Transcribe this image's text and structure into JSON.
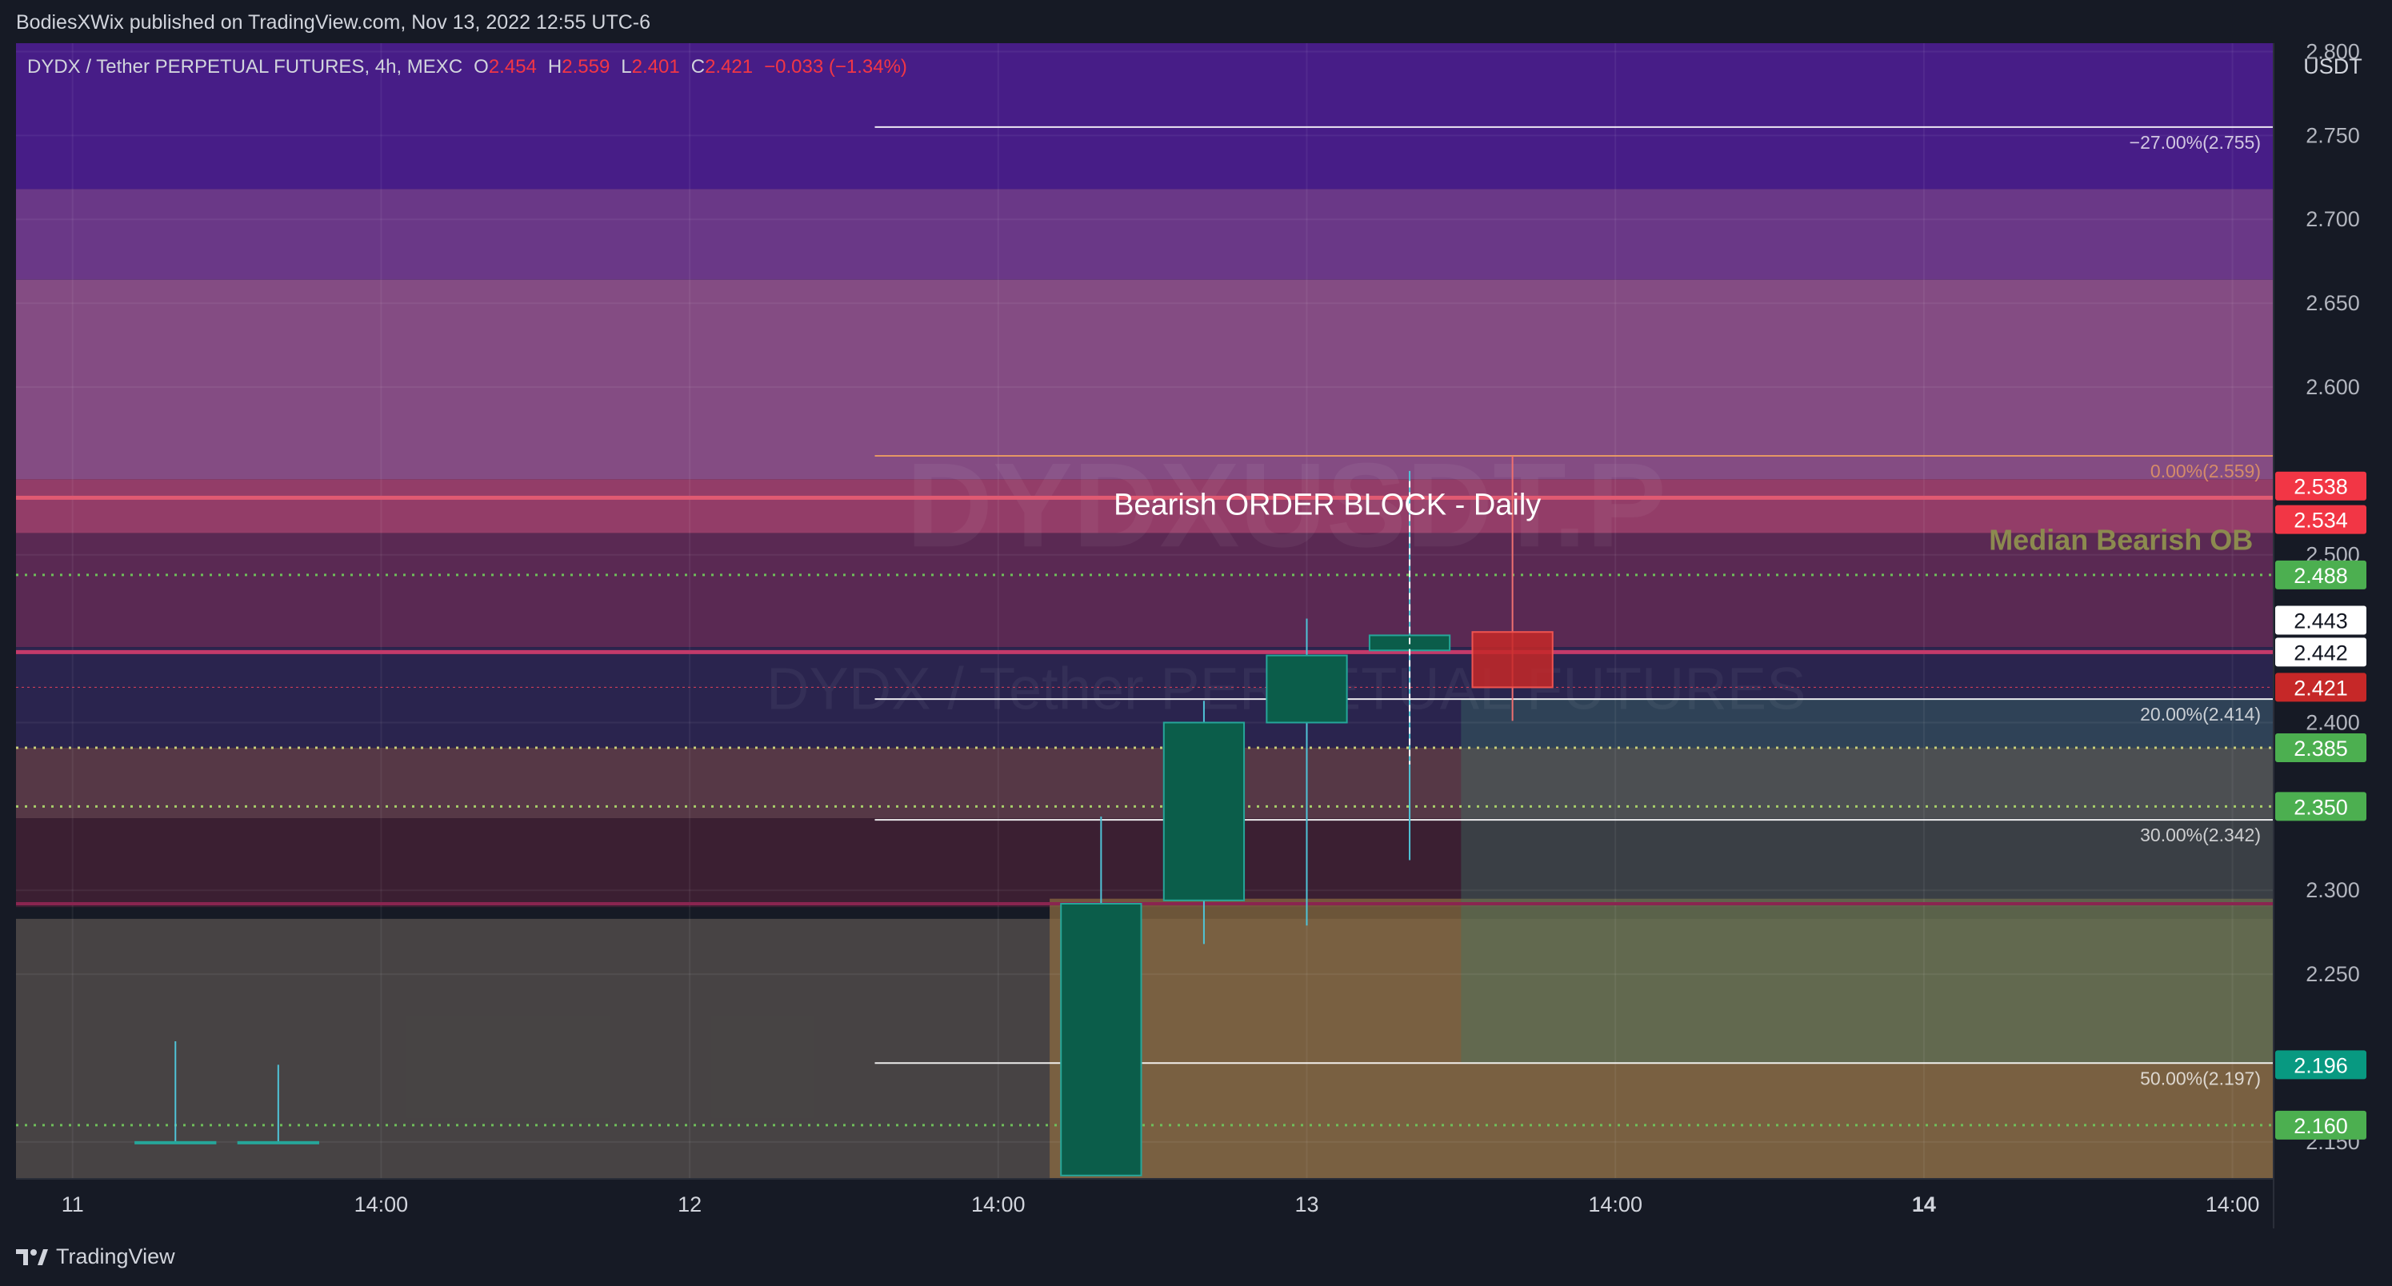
{
  "header": {
    "published": "BodiesXWix published on TradingView.com, Nov 13, 2022 12:55 UTC-6"
  },
  "legend": {
    "symbol": "DYDX / Tether PERPETUAL FUTURES, 4h, MEXC",
    "o_label": "O",
    "o": "2.454",
    "h_label": "H",
    "h": "2.559",
    "l_label": "L",
    "l": "2.401",
    "c_label": "C",
    "c": "2.421",
    "change": "−0.033 (−1.34%)"
  },
  "watermark": {
    "line1": "DYDXUSDT.P",
    "line2": "DYDX / Tether PERPETUAL FUTURES"
  },
  "footer": {
    "brand": "TradingView",
    "logo_icon": "tradingview-logo-icon"
  },
  "colors": {
    "background": "#161a25",
    "up": "#0b5d4a",
    "up_border": "#26a69a",
    "down": "#c62828",
    "down_border": "#ef5350",
    "label_red": "#f23645",
    "label_green": "#4caf50",
    "label_teal": "#089981",
    "median_label": "#8c8a4f"
  },
  "chart_data": {
    "type": "candlestick",
    "currency": "USDT",
    "timeframe": "4h",
    "ylim": [
      2.128,
      2.805
    ],
    "y_ticks": [
      "2.150",
      "2.250",
      "2.300",
      "2.400",
      "2.500",
      "2.600",
      "2.650",
      "2.700",
      "2.750",
      "2.800"
    ],
    "x_ticks": [
      {
        "label": "11",
        "bar": 0,
        "bold": false
      },
      {
        "label": "14:00",
        "bar": 3,
        "bold": false
      },
      {
        "label": "12",
        "bar": 6,
        "bold": false
      },
      {
        "label": "14:00",
        "bar": 9,
        "bold": false
      },
      {
        "label": "13",
        "bar": 12,
        "bold": false
      },
      {
        "label": "14:00",
        "bar": 15,
        "bold": false
      },
      {
        "label": "14",
        "bar": 18,
        "bold": true
      },
      {
        "label": "14:00",
        "bar": 21,
        "bold": false
      }
    ],
    "bar_range": [
      -0.55,
      21.4
    ],
    "candles": [
      {
        "bar": 1,
        "o": 2.15,
        "h": 2.21,
        "l": 2.15,
        "c": 2.15
      },
      {
        "bar": 2,
        "o": 2.15,
        "h": 2.196,
        "l": 2.15,
        "c": 2.15
      },
      {
        "bar": 10,
        "o": 2.13,
        "h": 2.344,
        "l": 2.13,
        "c": 2.292
      },
      {
        "bar": 11,
        "o": 2.294,
        "h": 2.413,
        "l": 2.268,
        "c": 2.4
      },
      {
        "bar": 12,
        "o": 2.4,
        "h": 2.462,
        "l": 2.279,
        "c": 2.44
      },
      {
        "bar": 13,
        "o": 2.443,
        "h": 2.55,
        "l": 2.318,
        "c": 2.452
      },
      {
        "bar": 14,
        "o": 2.454,
        "h": 2.559,
        "l": 2.401,
        "c": 2.421
      }
    ],
    "zones": [
      {
        "from": 2.718,
        "to": 2.805,
        "color": "#4a1e8c",
        "opacity": 0.95,
        "bar_from": -0.55,
        "bar_to": 21.4
      },
      {
        "from": 2.664,
        "to": 2.718,
        "color": "#6f3a8c",
        "opacity": 0.95,
        "bar_from": -0.55,
        "bar_to": 21.4
      },
      {
        "from": 2.545,
        "to": 2.664,
        "color": "#8a4f88",
        "opacity": 0.95,
        "bar_from": -0.55,
        "bar_to": 21.4
      },
      {
        "from": 2.513,
        "to": 2.545,
        "color": "#9a3f6c",
        "opacity": 0.95,
        "bar_from": -0.55,
        "bar_to": 21.4
      },
      {
        "from": 2.445,
        "to": 2.513,
        "color": "#5e2a55",
        "opacity": 0.95,
        "bar_from": -0.55,
        "bar_to": 21.4
      },
      {
        "from": 2.385,
        "to": 2.445,
        "color": "#2b2550",
        "opacity": 0.95,
        "bar_from": -0.55,
        "bar_to": 21.4
      },
      {
        "from": 2.343,
        "to": 2.385,
        "color": "#5a3a48",
        "opacity": 0.95,
        "bar_from": -0.55,
        "bar_to": 21.4
      },
      {
        "from": 2.29,
        "to": 2.343,
        "color": "#3d2033",
        "opacity": 0.95,
        "bar_from": -0.55,
        "bar_to": 21.4
      },
      {
        "from": 2.128,
        "to": 2.283,
        "color": "#4a4646",
        "opacity": 0.95,
        "bar_from": -0.55,
        "bar_to": 21.4
      },
      {
        "from": 2.128,
        "to": 2.295,
        "color": "#8a6a40",
        "opacity": 0.75,
        "bar_from": 9.5,
        "bar_to": 21.4
      },
      {
        "from": 2.197,
        "to": 2.414,
        "color": "#3a7a6a",
        "opacity": 0.35,
        "bar_from": 13.5,
        "bar_to": 21.4
      }
    ],
    "levels": [
      {
        "price": 2.534,
        "color": "#e05a72",
        "width": 5,
        "dash": ""
      },
      {
        "price": 2.442,
        "color": "#c33a6a",
        "width": 5,
        "dash": ""
      },
      {
        "price": 2.421,
        "color": "#e0405a",
        "width": 1,
        "dash": "3,4"
      },
      {
        "price": 2.488,
        "color": "#6fbf5a",
        "width": 3,
        "dash": "3,8"
      },
      {
        "price": 2.385,
        "color": "#c8cf7a",
        "width": 3,
        "dash": "3,8"
      },
      {
        "price": 2.35,
        "color": "#a8cf6a",
        "width": 3,
        "dash": "3,8"
      },
      {
        "price": 2.16,
        "color": "#6fbf5a",
        "width": 3,
        "dash": "3,8"
      },
      {
        "price": 2.292,
        "color": "#8a2550",
        "width": 4,
        "dash": ""
      }
    ],
    "fib": [
      {
        "label": "−27.00%(2.755)",
        "price": 2.755,
        "color": "#ffffff"
      },
      {
        "label": "0.00%(2.559)",
        "price": 2.559,
        "color": "#f0a060"
      },
      {
        "label": "20.00%(2.414)",
        "price": 2.414,
        "color": "#ffffff"
      },
      {
        "label": "30.00%(2.342)",
        "price": 2.342,
        "color": "#ffffff"
      },
      {
        "label": "50.00%(2.197)",
        "price": 2.197,
        "color": "#ffffff"
      }
    ],
    "fib_bar_start": 7.8,
    "annotations": [
      {
        "text": "Bearish ORDER BLOCK - Daily",
        "price": 2.524,
        "bar": 12.2,
        "color": "#ffffff",
        "size": 38
      },
      {
        "text": "Median Bearish OB",
        "price": 2.503,
        "bar": 21.2,
        "color": "#8c8a4f",
        "size": 36,
        "anchor": "end",
        "bold": true
      }
    ],
    "price_labels": [
      {
        "text": "2.538",
        "price": 2.541,
        "bg": "#f23645",
        "fg": "#ffffff"
      },
      {
        "text": "2.534",
        "price": 2.521,
        "bg": "#f23645",
        "fg": "#ffffff"
      },
      {
        "text": "2.488",
        "price": 2.488,
        "bg": "#4caf50",
        "fg": "#ffffff"
      },
      {
        "text": "2.443",
        "price": 2.461,
        "bg": "#ffffff",
        "fg": "#131722"
      },
      {
        "text": "2.442",
        "price": 2.442,
        "bg": "#ffffff",
        "fg": "#131722"
      },
      {
        "text": "2.421",
        "price": 2.421,
        "bg": "#c62828",
        "fg": "#ffffff"
      },
      {
        "text": "2.385",
        "price": 2.385,
        "bg": "#4caf50",
        "fg": "#ffffff"
      },
      {
        "text": "2.350",
        "price": 2.35,
        "bg": "#4caf50",
        "fg": "#ffffff"
      },
      {
        "text": "2.196",
        "price": 2.196,
        "bg": "#089981",
        "fg": "#ffffff"
      },
      {
        "text": "2.160",
        "price": 2.16,
        "bg": "#4caf50",
        "fg": "#ffffff"
      }
    ]
  }
}
